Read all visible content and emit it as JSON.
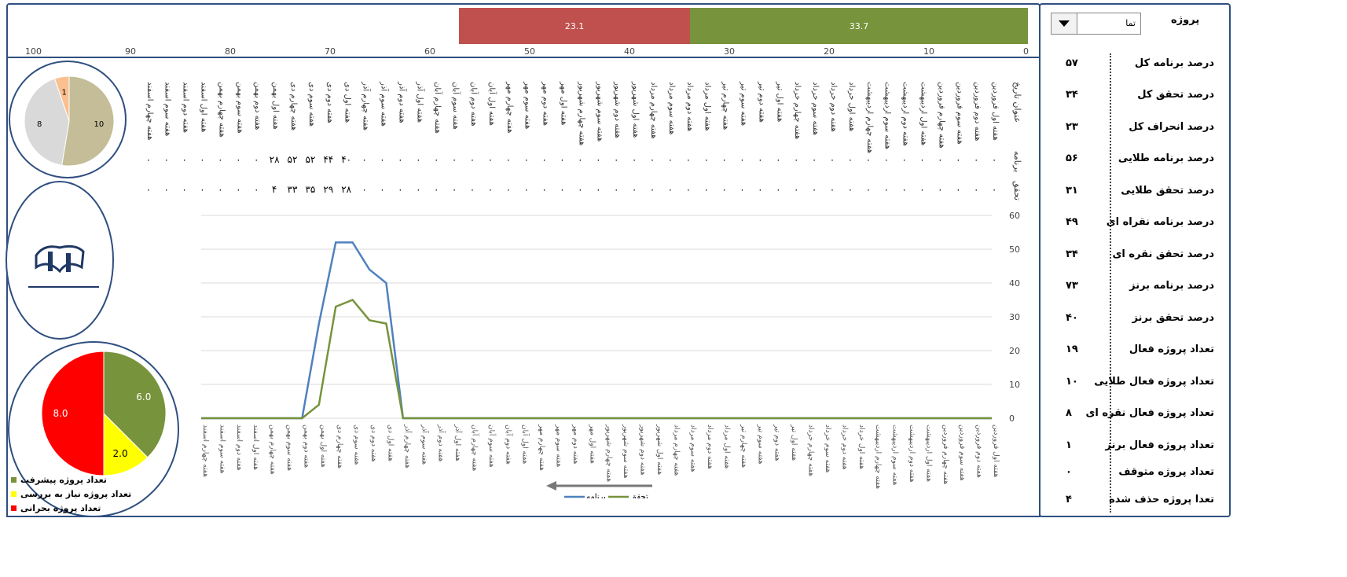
{
  "topbar": {
    "red_value": "23.1",
    "green_value": "33.7",
    "red_color": "#c0504d",
    "green_color": "#77933c",
    "axis_ticks": [
      "100",
      "90",
      "80",
      "70",
      "60",
      "50",
      "40",
      "30",
      "20",
      "10",
      "0"
    ]
  },
  "dropdown": {
    "value": "تما",
    "arrow_icon": "triangle-down"
  },
  "header_label": "پروژه",
  "kpis": [
    {
      "label": "درصد برنامه کل",
      "value": "۵۷"
    },
    {
      "label": "درصد تحقق کل",
      "value": "۳۴"
    },
    {
      "label": "درصد انحراف کل",
      "value": "۲۳"
    },
    {
      "label": "درصد برنامه طلایی",
      "value": "۵۶"
    },
    {
      "label": "درصد تحقق طلایی",
      "value": "۳۱"
    },
    {
      "label": "درصد برنامه نقراه ای",
      "value": "۴۹"
    },
    {
      "label": "درصد تحقق نقره ای",
      "value": "۳۴"
    },
    {
      "label": "درصد برنامه برنز",
      "value": "۷۳"
    },
    {
      "label": "درصد تحقق برنز",
      "value": "۴۰"
    },
    {
      "label": "تعداد پروژه فعال",
      "value": "۱۹"
    },
    {
      "label": "تعداد پروژه فعال طلایی",
      "value": "۱۰"
    },
    {
      "label": "تعداد پروژه فعال نقره ای",
      "value": "۸"
    },
    {
      "label": "تعداد پروژه فعال برنز",
      "value": "۱"
    },
    {
      "label": "تعداد پروژه متوقف",
      "value": "۰"
    },
    {
      "label": "تعدا پروژه حذف شده",
      "value": "۴"
    }
  ],
  "table": {
    "row_header_title": "عنوان تاریخ",
    "row_header_plan": "برنامه",
    "row_header_actual": "تحقق",
    "weeks": [
      "هفته اول فروردین",
      "هفته دوم فروردین",
      "هفته سوم فروردین",
      "هفته چهارم فروردین",
      "هفته اول اردیبهشت",
      "هفته دوم اردیبهشت",
      "هفته سوم اردیبهشت",
      "هفته چهارم اردیبهشت",
      "هفته اول خرداد",
      "هفته دوم خرداد",
      "هفته سوم خرداد",
      "هفته چهارم خرداد",
      "هفته اول تیر",
      "هفته دوم تیر",
      "هفته سوم تیر",
      "هفته چهارم تیر",
      "هفته اول مرداد",
      "هفته دوم مرداد",
      "هفته سوم مرداد",
      "هفته چهارم مرداد",
      "هفته اول شهریور",
      "هفته دوم شهریور",
      "هفته سوم شهریور",
      "هفته چهارم شهریور",
      "هفته اول مهر",
      "هفته دوم مهر",
      "هفته سوم مهر",
      "هفته چهارم مهر",
      "هفته اول آبان",
      "هفته دوم آبان",
      "هفته سوم آبان",
      "هفته چهارم آبان",
      "هفته اول آذر",
      "هفته دوم آذر",
      "هفته سوم آذر",
      "هفته چهارم آذر",
      "هفته اول دی",
      "هفته دوم دی",
      "هفته سوم دی",
      "هفته چهارم دی",
      "هفته اول بهمن",
      "هفته دوم بهمن",
      "هفته سوم بهمن",
      "هفته چهارم بهمن",
      "هفته اول اسفند",
      "هفته دوم اسفند",
      "هفته سوم اسفند",
      "هفته چهارم اسفند"
    ],
    "plan_row": [
      "۰",
      "۰",
      "۰",
      "۰",
      "۰",
      "۰",
      "۰",
      "۰",
      "۰",
      "۰",
      "۰",
      "۰",
      "۰",
      "۰",
      "۰",
      "۰",
      "۰",
      "۰",
      "۰",
      "۰",
      "۰",
      "۰",
      "۰",
      "۰",
      "۰",
      "۰",
      "۰",
      "۰",
      "۰",
      "۰",
      "۰",
      "۰",
      "۰",
      "۰",
      "۰",
      "۰",
      "۴۰",
      "۴۴",
      "۵۲",
      "۵۲",
      "۲۸",
      "۰",
      "۰",
      "۰",
      "۰",
      "۰",
      "۰",
      "۰"
    ],
    "actual_row": [
      "۰",
      "۰",
      "۰",
      "۰",
      "۰",
      "۰",
      "۰",
      "۰",
      "۰",
      "۰",
      "۰",
      "۰",
      "۰",
      "۰",
      "۰",
      "۰",
      "۰",
      "۰",
      "۰",
      "۰",
      "۰",
      "۰",
      "۰",
      "۰",
      "۰",
      "۰",
      "۰",
      "۰",
      "۰",
      "۰",
      "۰",
      "۰",
      "۰",
      "۰",
      "۰",
      "۰",
      "۲۸",
      "۲۹",
      "۳۵",
      "۳۳",
      "۴",
      "۰",
      "۰",
      "۰",
      "۰",
      "۰",
      "۰",
      "۰"
    ]
  },
  "chart_data": [
    {
      "type": "line",
      "y_ticks": [
        "0",
        "10",
        "20",
        "30",
        "40",
        "50",
        "60"
      ],
      "ylim": [
        0,
        60
      ],
      "x": [
        "هفته چهارم اسفند",
        "هفته سوم اسفند",
        "هفته دوم اسفند",
        "هفته اول اسفند",
        "هفته چهارم بهمن",
        "هفته سوم بهمن",
        "هفته دوم بهمن",
        "هفته اول بهمن",
        "هفته چهارم دی",
        "هفته سوم دی",
        "هفته دوم دی",
        "هفته اول دی",
        "هفته چهارم آذر",
        "هفته سوم آذر",
        "هفته دوم آذر",
        "هفته اول آذر",
        "هفته چهارم آبان",
        "هفته سوم آبان",
        "هفته دوم آبان",
        "هفته اول آبان",
        "هفته چهارم مهر",
        "هفته سوم مهر",
        "هفته دوم مهر",
        "هفته اول مهر",
        "هفته چهارم شهریور",
        "هفته سوم شهریور",
        "هفته دوم شهریور",
        "هفته اول شهریور",
        "هفته چهارم مرداد",
        "هفته سوم مرداد",
        "هفته دوم مرداد",
        "هفته اول مرداد",
        "هفته چهارم تیر",
        "هفته سوم تیر",
        "هفته دوم تیر",
        "هفته اول تیر",
        "هفته چهارم خرداد",
        "هفته سوم خرداد",
        "هفته دوم خرداد",
        "هفته اول خرداد",
        "هفته چهارم اردیبهشت",
        "هفته سوم اردیبهشت",
        "هفته دوم اردیبهشت",
        "هفته اول اردیبهشت",
        "هفته چهارم فروردین",
        "هفته سوم فروردین",
        "هفته دوم فروردین",
        "هفته اول فروردین"
      ],
      "series": [
        {
          "name": "برنامه",
          "color": "#4f81bd",
          "values": [
            0,
            0,
            0,
            0,
            0,
            0,
            0,
            28,
            52,
            52,
            44,
            40,
            0,
            0,
            0,
            0,
            0,
            0,
            0,
            0,
            0,
            0,
            0,
            0,
            0,
            0,
            0,
            0,
            0,
            0,
            0,
            0,
            0,
            0,
            0,
            0,
            0,
            0,
            0,
            0,
            0,
            0,
            0,
            0,
            0,
            0,
            0,
            0
          ]
        },
        {
          "name": "تحقق",
          "color": "#77933c",
          "values": [
            0,
            0,
            0,
            0,
            0,
            0,
            0,
            4,
            33,
            35,
            29,
            28,
            0,
            0,
            0,
            0,
            0,
            0,
            0,
            0,
            0,
            0,
            0,
            0,
            0,
            0,
            0,
            0,
            0,
            0,
            0,
            0,
            0,
            0,
            0,
            0,
            0,
            0,
            0,
            0,
            0,
            0,
            0,
            0,
            0,
            0,
            0,
            0
          ]
        }
      ],
      "legend": "bottom"
    },
    {
      "type": "pie",
      "labels": [
        "",
        "",
        " "
      ],
      "values": [
        10,
        8,
        1
      ],
      "colors": [
        "#c4bd97",
        "#d9d9d9",
        "#fac090"
      ]
    },
    {
      "type": "pie",
      "labels": [
        "تعداد پروژه پیشرفت",
        "تعداد پروژه نیاز به بررسی",
        "تعداد پروژه بحرانی"
      ],
      "values": [
        6.0,
        2.0,
        8.0
      ],
      "value_labels": [
        "6.0",
        "2.0",
        "8.0"
      ],
      "colors": [
        "#77933c",
        "#ffff00",
        "#ff0000"
      ],
      "legend": "bottom-left"
    }
  ],
  "pie1_labels": [
    "10",
    "8",
    "1"
  ],
  "legend_bottom": {
    "plan": "برنامه",
    "actual": "تحقق"
  }
}
